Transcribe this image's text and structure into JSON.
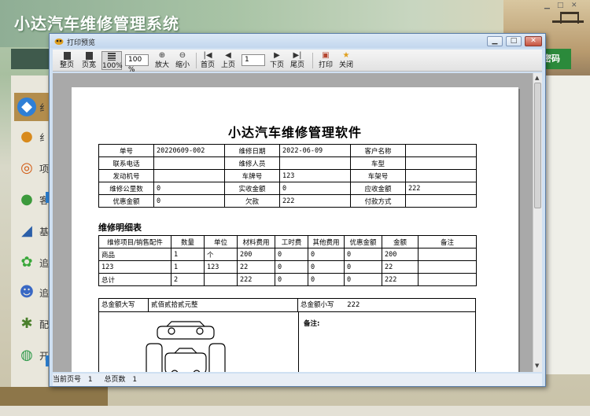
{
  "app": {
    "title": "小达汽车维修管理系统",
    "green_button": "密码",
    "sidebar_labels": [
      "纟",
      "纟",
      "项",
      "客",
      "基",
      "追",
      "追",
      "配",
      "开"
    ]
  },
  "dialog": {
    "title": "打印预览",
    "toolbar": {
      "whole_page": "整页",
      "page_width": "页宽",
      "percent100": "100%",
      "zoom_value": "100 %",
      "zoom_in": "放大",
      "zoom_out": "缩小",
      "first_page": "首页",
      "prev_page": "上页",
      "page_input": "1",
      "next_page": "下页",
      "last_page": "尾页",
      "print": "打印",
      "close": "关闭"
    },
    "status": {
      "current_label": "当前页号",
      "current_value": "1",
      "total_label": "总页数",
      "total_value": "1"
    }
  },
  "document": {
    "title": "小达汽车维修管理软件",
    "header": {
      "order_no_label": "单号",
      "order_no": "20220609-002",
      "date_label": "维修日期",
      "date": "2022-06-09",
      "customer_label": "客户名称",
      "customer": "",
      "phone_label": "联系电话",
      "phone": "",
      "staff_label": "维修人员",
      "staff": "",
      "model_label": "车型",
      "model": "",
      "engine_label": "发动机号",
      "engine": "",
      "plate_label": "车牌号",
      "plate": "123",
      "frame_label": "车架号",
      "frame": "",
      "km_label": "维修公里数",
      "km": "0",
      "received_label": "实收金额",
      "received": "0",
      "due_label": "应收金额",
      "due": "222",
      "discount_label": "优惠金额",
      "discount": "0",
      "owed_label": "欠款",
      "owed": "222",
      "pay_label": "付款方式",
      "pay": ""
    },
    "detail_title": "维修明细表",
    "detail": {
      "columns": [
        "维修项目/销售配件",
        "数量",
        "单位",
        "材料费用",
        "工时费",
        "其他费用",
        "优惠金额",
        "金额",
        "备注"
      ],
      "rows": [
        [
          "商品",
          "1",
          "个",
          "200",
          "0",
          "0",
          "0",
          "200",
          ""
        ],
        [
          "123",
          "1",
          "123",
          "22",
          "0",
          "0",
          "0",
          "22",
          ""
        ],
        [
          "总计",
          "2",
          "",
          "222",
          "0",
          "0",
          "0",
          "222",
          ""
        ]
      ]
    },
    "total_upper_label": "总金额大写",
    "total_upper": "贰佰贰拾贰元整",
    "total_lower_label": "总金额小写",
    "total_lower": "222",
    "remark_label": "备注:"
  }
}
